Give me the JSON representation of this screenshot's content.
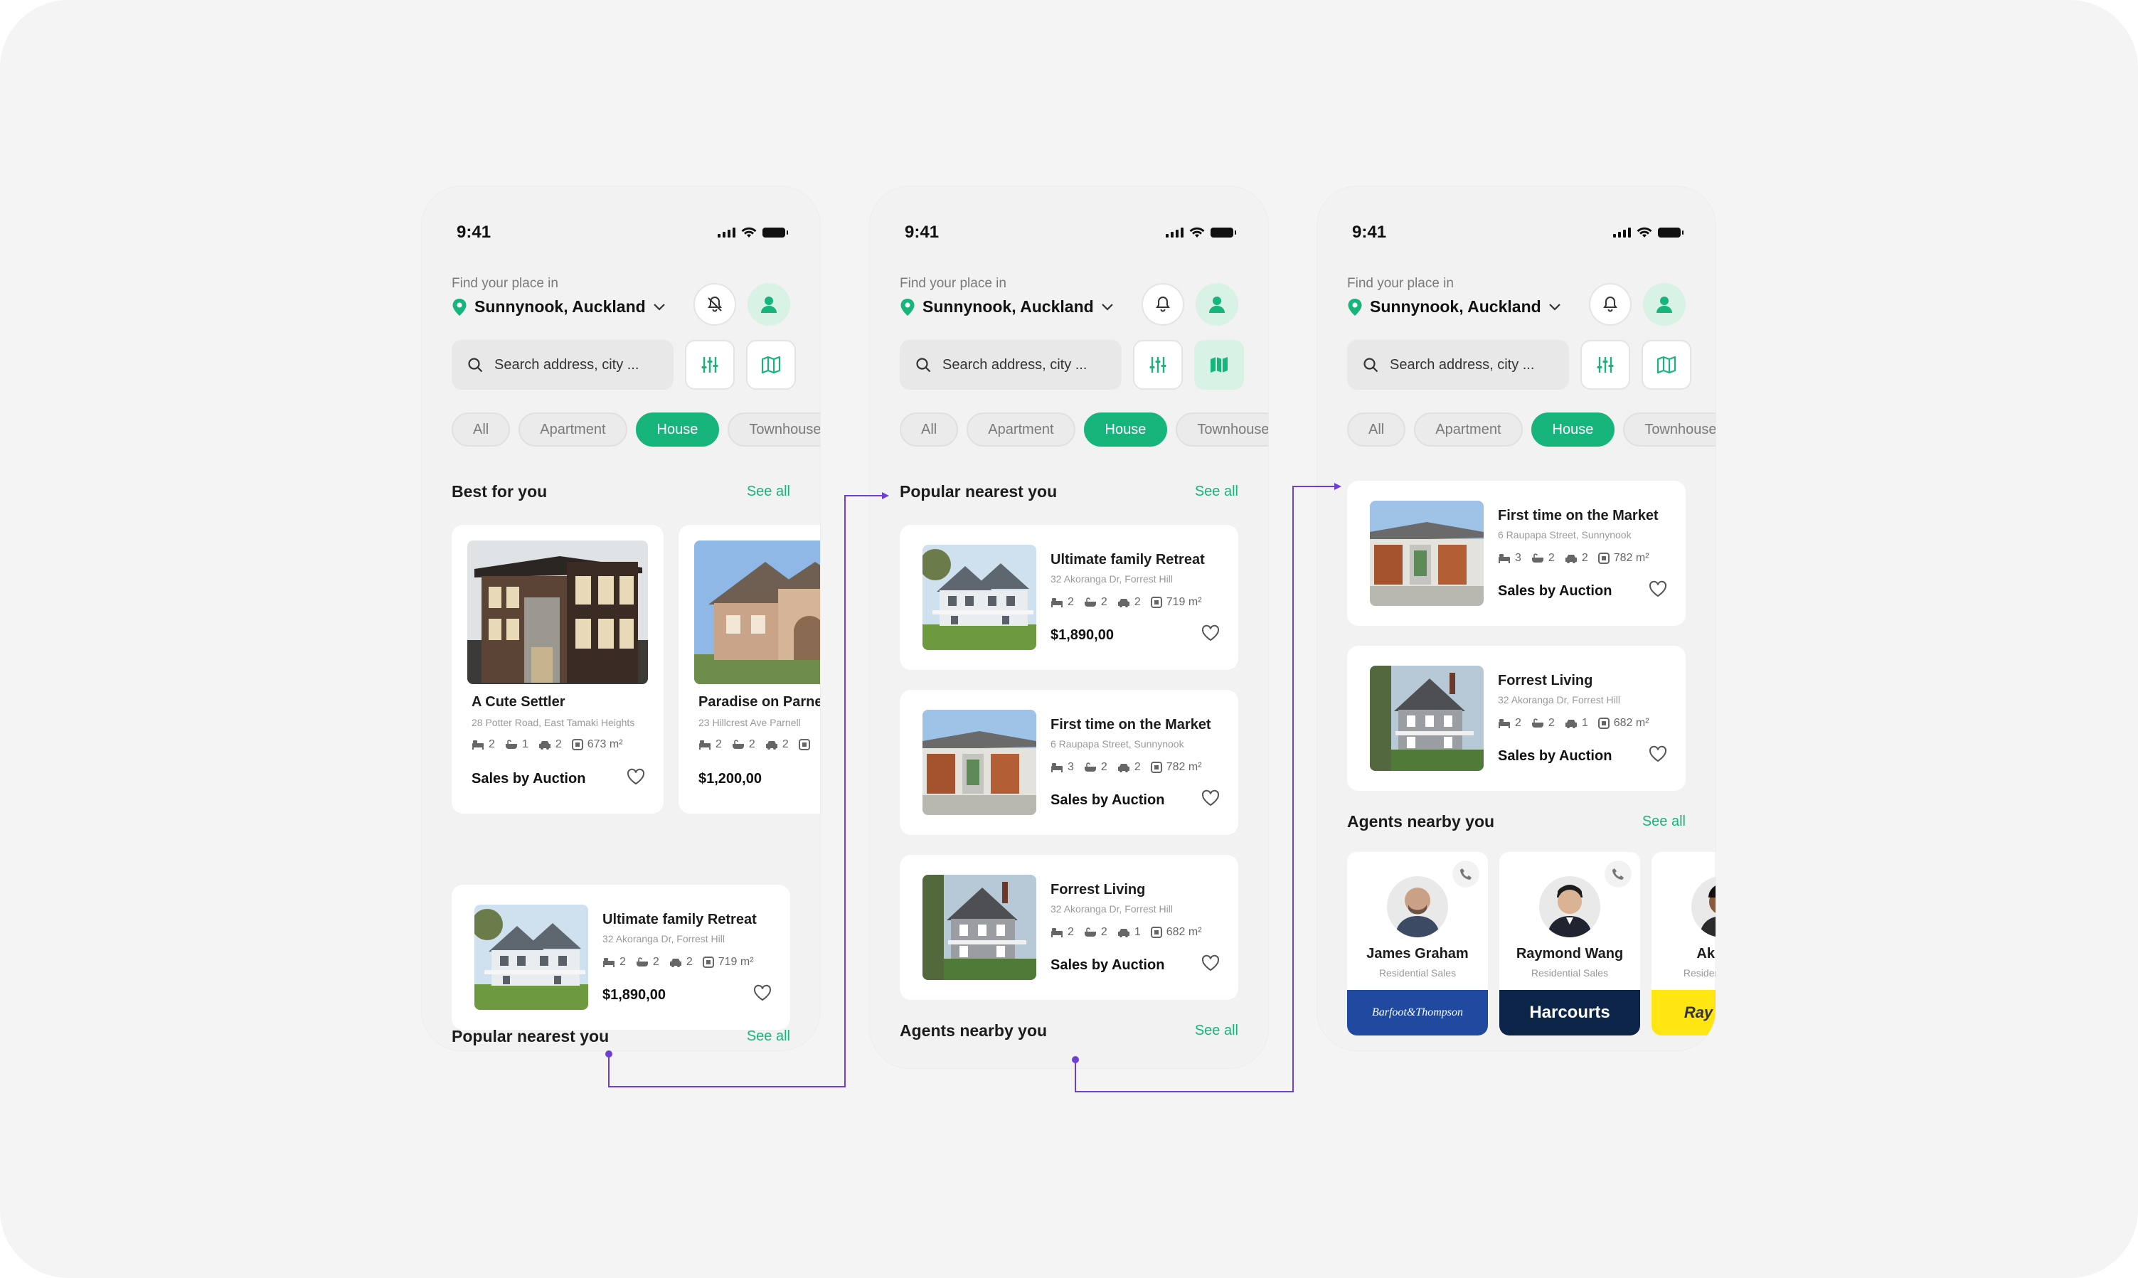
{
  "colors": {
    "brand_green": "#17b47c",
    "connector_purple": "#6d3fd6"
  },
  "screens": [
    {
      "status": {
        "time": "9:41"
      },
      "header": {
        "find_label": "Find your place in",
        "location": "Sunnynook, Auckland"
      },
      "search": {
        "placeholder": "Search address, city ..."
      },
      "chips": [
        "All",
        "Apartment",
        "House",
        "Townhouse"
      ],
      "active_chip": "House",
      "best": {
        "title": "Best for you",
        "see_all": "See all",
        "cards": [
          {
            "title": "A Cute Settler",
            "address": "28 Potter Road, East Tamaki Heights",
            "beds": "2",
            "baths": "1",
            "cars": "2",
            "area": "673 m²",
            "price": "Sales by Auction"
          },
          {
            "title": "Paradise on Parnell",
            "address": "23 Hillcrest Ave Parnell",
            "beds": "2",
            "baths": "2",
            "cars": "2",
            "area": "",
            "price": "$1,200,00"
          }
        ]
      },
      "popular": {
        "title": "Popular nearest you",
        "see_all": "See all",
        "cards": [
          {
            "title": "Ultimate family Retreat",
            "address": "32 Akoranga Dr, Forrest Hill",
            "beds": "2",
            "baths": "2",
            "cars": "2",
            "area": "719 m²",
            "price": "$1,890,00"
          }
        ]
      }
    },
    {
      "status": {
        "time": "9:41"
      },
      "header": {
        "find_label": "Find your place in",
        "location": "Sunnynook, Auckland"
      },
      "search": {
        "placeholder": "Search address, city ..."
      },
      "chips": [
        "All",
        "Apartment",
        "House",
        "Townhouse"
      ],
      "active_chip": "House",
      "popular": {
        "title": "Popular nearest you",
        "see_all": "See all",
        "cards": [
          {
            "title": "Ultimate family Retreat",
            "address": "32 Akoranga Dr, Forrest Hill",
            "beds": "2",
            "baths": "2",
            "cars": "2",
            "area": "719 m²",
            "price": "$1,890,00"
          },
          {
            "title": "First time on the Market",
            "address": "6 Raupapa Street, Sunnynook",
            "beds": "3",
            "baths": "2",
            "cars": "2",
            "area": "782 m²",
            "price": "Sales by Auction"
          },
          {
            "title": "Forrest Living",
            "address": "32 Akoranga Dr, Forrest Hill",
            "beds": "2",
            "baths": "2",
            "cars": "1",
            "area": "682 m²",
            "price": "Sales by Auction"
          }
        ]
      },
      "agents": {
        "title": "Agents nearby you",
        "see_all": "See all"
      }
    },
    {
      "status": {
        "time": "9:41"
      },
      "header": {
        "find_label": "Find your place in",
        "location": "Sunnynook, Auckland"
      },
      "search": {
        "placeholder": "Search address, city ..."
      },
      "chips": [
        "All",
        "Apartment",
        "House",
        "Townhouse"
      ],
      "active_chip": "House",
      "popular": {
        "cards": [
          {
            "title": "First time on the Market",
            "address": "6 Raupapa Street, Sunnynook",
            "beds": "3",
            "baths": "2",
            "cars": "2",
            "area": "782 m²",
            "price": "Sales by Auction"
          },
          {
            "title": "Forrest Living",
            "address": "32 Akoranga Dr, Forrest Hill",
            "beds": "2",
            "baths": "2",
            "cars": "1",
            "area": "682 m²",
            "price": "Sales by Auction"
          }
        ]
      },
      "agents": {
        "title": "Agents nearby you",
        "see_all": "See all",
        "items": [
          {
            "name": "James Graham",
            "role": "Residential Sales",
            "brand": "Barfoot&Thompson",
            "brand_color": "#1f4aa0"
          },
          {
            "name": "Raymond Wang",
            "role": "Residential Sales",
            "brand": "Harcourts",
            "brand_color": "#0b2447"
          },
          {
            "name": "Akshay",
            "role": "Residential Sales",
            "brand": "Ray White",
            "brand_color": "#ffe512"
          }
        ]
      }
    }
  ]
}
